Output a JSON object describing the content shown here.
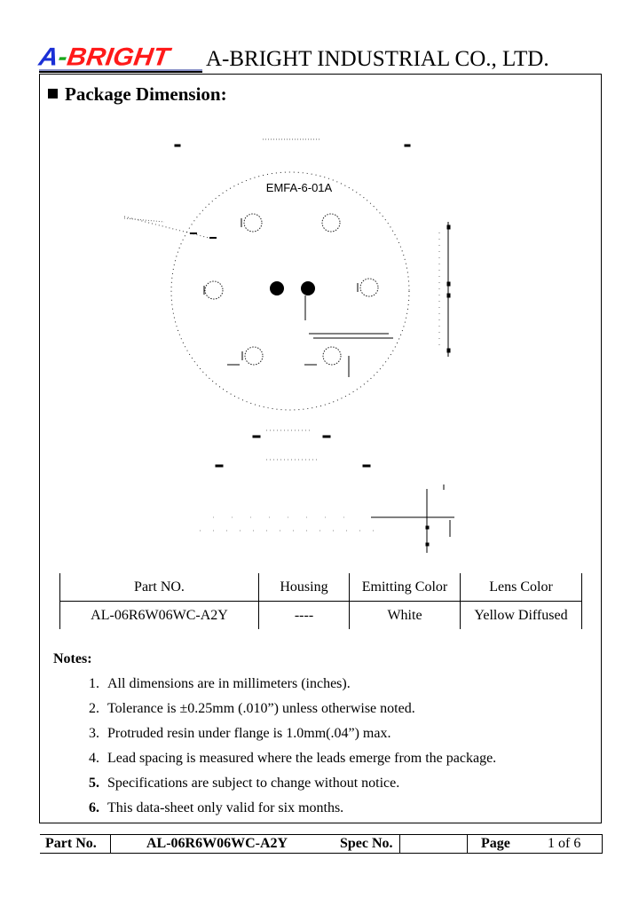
{
  "header": {
    "logo": {
      "part_a": "A",
      "part_dash": "-",
      "part_bright": "BRIGHT"
    },
    "company_name": "A-BRIGHT INDUSTRIAL CO., LTD.",
    "colors": {
      "logo_blue": "#1a2fd6",
      "logo_green": "#19a81c",
      "logo_red": "#ff1a1a"
    }
  },
  "section": {
    "title": "Package Dimension:"
  },
  "drawing": {
    "label": "EMFA-6-01A"
  },
  "spec_table": {
    "columns": [
      "Part NO.",
      "Housing",
      "Emitting Color",
      "Lens Color"
    ],
    "rows": [
      [
        "AL-06R6W06WC-A2Y",
        "----",
        "White",
        "Yellow Diffused"
      ]
    ]
  },
  "notes": {
    "title": "Notes:",
    "items": [
      {
        "num": "1.",
        "text": "All dimensions are in millimeters (inches)."
      },
      {
        "num": "2.",
        "text": "Tolerance is  ±0.25mm (.010”) unless otherwise noted."
      },
      {
        "num": "3.",
        "text": "Protruded resin under flange is 1.0mm(.04”) max."
      },
      {
        "num": "4.",
        "text": "Lead spacing is measured where the leads emerge from the package."
      },
      {
        "num": "5.",
        "text": "Specifications are subject to change without notice."
      },
      {
        "num": "6.",
        "text": "This data-sheet only valid for six months."
      }
    ]
  },
  "footer": {
    "part_no_label": "Part No.",
    "part_no_value": "AL-06R6W06WC-A2Y",
    "spec_no_label": "Spec No.",
    "spec_no_value": "",
    "page_label": "Page",
    "page_value": "1 of 6"
  }
}
